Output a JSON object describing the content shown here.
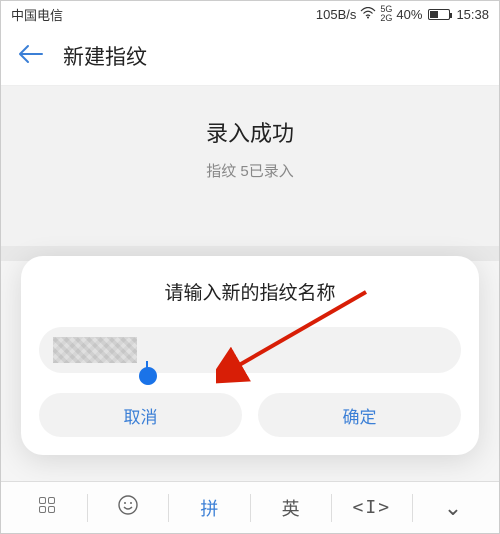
{
  "status": {
    "carrier": "中国电信",
    "speed": "105B/s",
    "network": "5G",
    "battery_pct": "40%",
    "time": "15:38"
  },
  "header": {
    "title": "新建指纹"
  },
  "main": {
    "title": "录入成功",
    "subtitle": "指纹 5已录入"
  },
  "dialog": {
    "title": "请输入新的指纹名称",
    "input_value": "",
    "cancel_label": "取消",
    "confirm_label": "确定"
  },
  "keyboard": {
    "mode_active": "拼",
    "mode_alt": "英",
    "collapse_glyph": "⌄"
  }
}
